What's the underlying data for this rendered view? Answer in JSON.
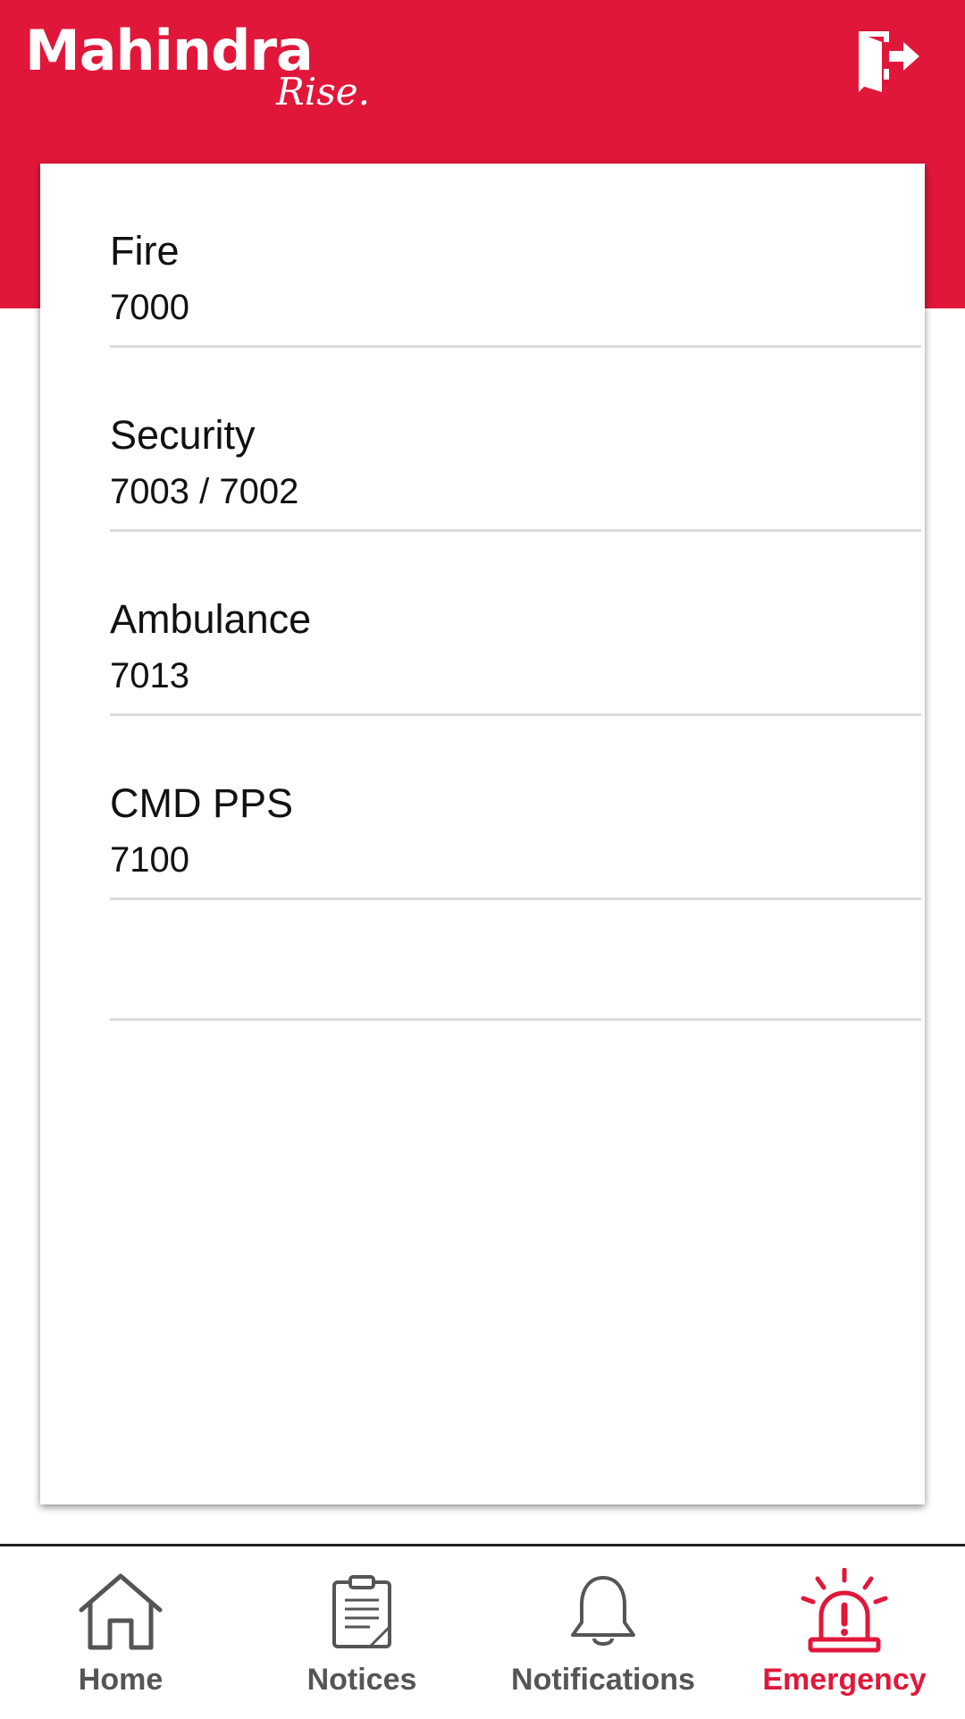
{
  "app": {
    "brand_name": "Mahindra",
    "brand_tagline": "Rise.",
    "accent_color": "#e1173a"
  },
  "header": {
    "exit_icon": "exit-door-icon"
  },
  "contacts": [
    {
      "name": "Fire",
      "number": "7000"
    },
    {
      "name": "Security",
      "number": "7003 / 7002"
    },
    {
      "name": "Ambulance",
      "number": "7013"
    },
    {
      "name": "CMD PPS",
      "number": "7100"
    }
  ],
  "bottom_nav": {
    "items": [
      {
        "label": "Home",
        "icon": "home-icon",
        "active": false
      },
      {
        "label": "Notices",
        "icon": "clipboard-icon",
        "active": false
      },
      {
        "label": "Notifications",
        "icon": "bell-icon",
        "active": false
      },
      {
        "label": "Emergency",
        "icon": "siren-icon",
        "active": true
      }
    ]
  }
}
